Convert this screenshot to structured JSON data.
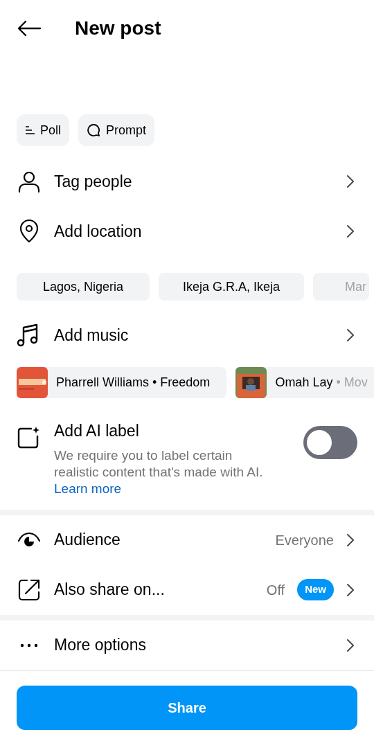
{
  "header": {
    "title": "New post"
  },
  "caption_tools": [
    {
      "kind": "poll",
      "label": "Poll"
    },
    {
      "kind": "prompt",
      "label": "Prompt"
    }
  ],
  "rows_top": [
    {
      "kind": "person",
      "label": "Tag people"
    },
    {
      "kind": "pin",
      "label": "Add location"
    }
  ],
  "location_suggestions": [
    {
      "label": "Lagos, Nigeria",
      "cut": false
    },
    {
      "label": "Ikeja G.R.A, Ikeja",
      "cut": false
    },
    {
      "label": "Mar",
      "cut": true
    }
  ],
  "music_row": {
    "label": "Add music"
  },
  "music_suggestions": [
    {
      "artist": "Pharrell Williams",
      "song": "• Freedom",
      "song_cut": false
    },
    {
      "artist": "Omah Lay",
      "song": "• Mov",
      "song_cut": true
    }
  ],
  "ai_label": {
    "title": "Add AI label",
    "description": "We require you to label certain realistic content that's made with AI.",
    "link": "Learn more",
    "on": false
  },
  "settings": [
    {
      "kind": "eye",
      "label": "Audience",
      "value": "Everyone"
    },
    {
      "kind": "share",
      "label": "Also share on...",
      "value": "Off",
      "badge": "New"
    }
  ],
  "more": {
    "label": "More options"
  },
  "share_button": "Share"
}
